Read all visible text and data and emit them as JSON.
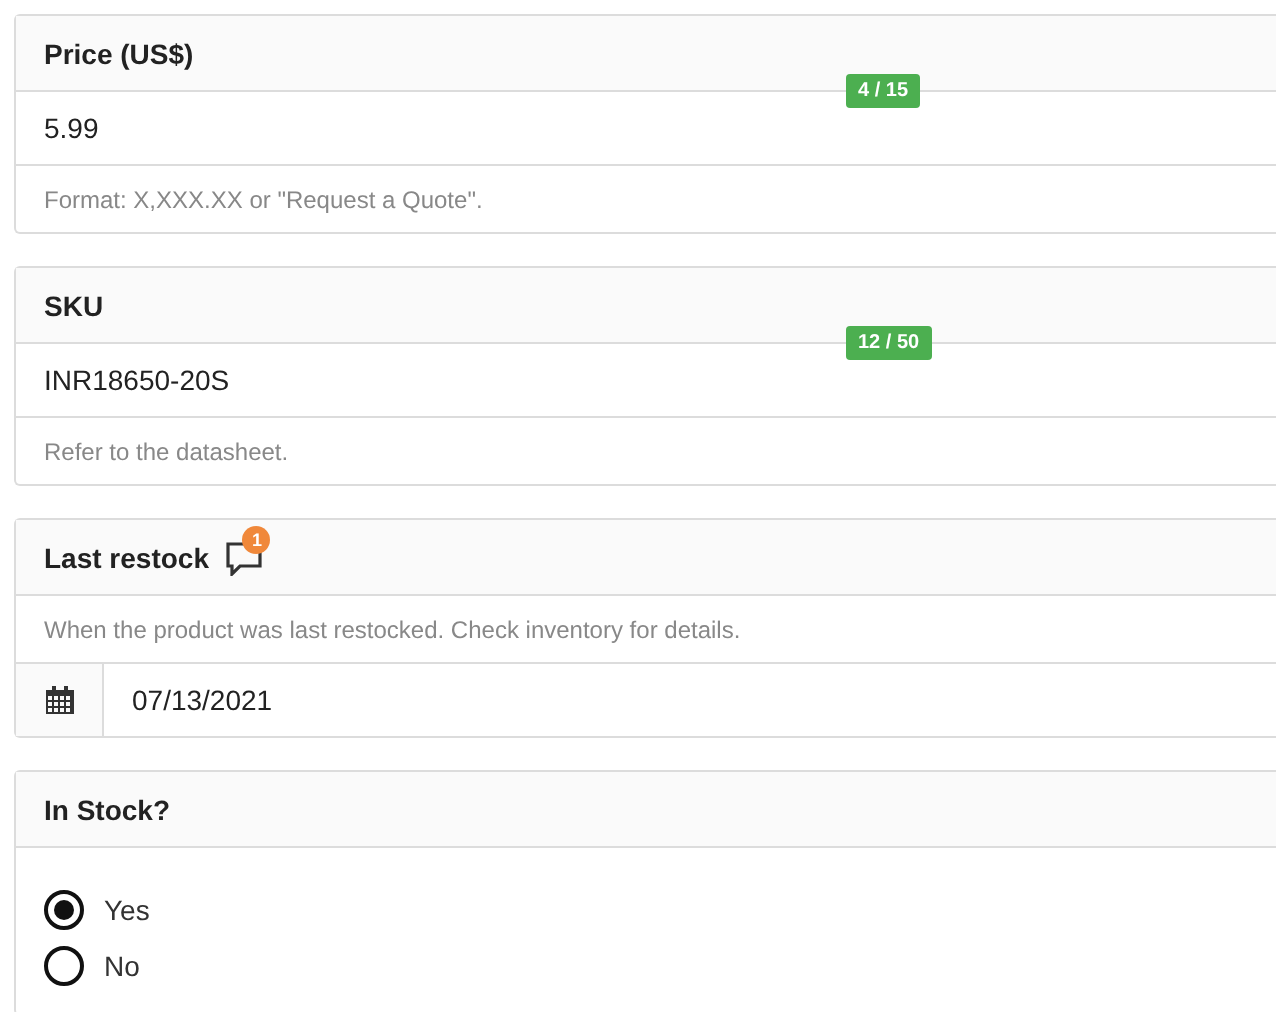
{
  "fields": [
    {
      "kind": "text",
      "label": "Price (US$)",
      "value": "5.99",
      "counter": "4 / 15",
      "help": "Format: X,XXX.XX or \"Request a Quote\"."
    },
    {
      "kind": "text",
      "label": "SKU",
      "value": "INR18650-20S",
      "counter": "12 / 50",
      "help": "Refer to the datasheet."
    },
    {
      "kind": "date",
      "label": "Last restock",
      "comments": "1",
      "help": "When the product was last restocked. Check inventory for details.",
      "value": "07/13/2021"
    },
    {
      "kind": "radio",
      "label": "In Stock?",
      "options": [
        {
          "label": "Yes",
          "selected": true
        },
        {
          "label": "No",
          "selected": false
        }
      ]
    }
  ]
}
